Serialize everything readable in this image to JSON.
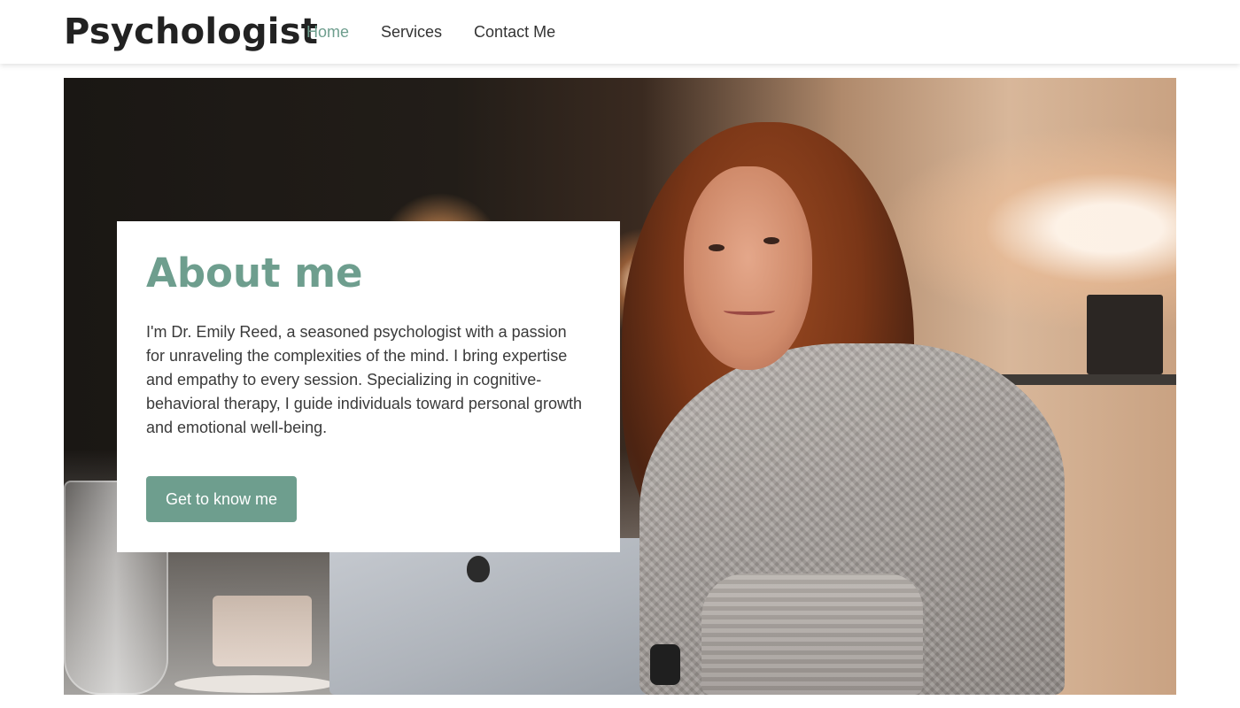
{
  "header": {
    "brand": "Psychologist",
    "nav": [
      {
        "label": "Home",
        "active": true
      },
      {
        "label": "Services",
        "active": false
      },
      {
        "label": "Contact Me",
        "active": false
      }
    ]
  },
  "hero": {
    "image_description": "",
    "about": {
      "title": "About me",
      "text": "I'm Dr. Emily Reed, a seasoned psychologist with a passion for unraveling the complexities of the mind. I bring expertise and empathy to every session. Specializing in cognitive-behavioral therapy, I guide individuals toward personal growth and emotional well-being.",
      "button_label": "Get to know me"
    }
  },
  "colors": {
    "accent": "#6e9e8e",
    "text": "#2b2b2b",
    "background": "#ffffff"
  }
}
